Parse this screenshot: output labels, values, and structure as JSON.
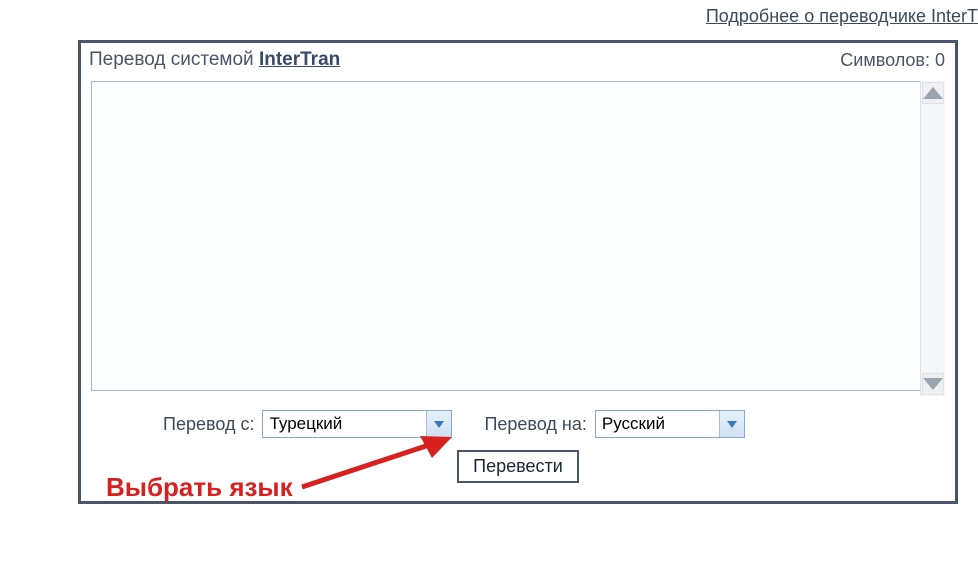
{
  "top_link": "Подробнее о переводчике InterT",
  "header": {
    "prefix": "Перевод системой ",
    "system": "InterTran"
  },
  "char_counter": {
    "label": "Символов: ",
    "value": "0"
  },
  "textarea": {
    "value": ""
  },
  "controls": {
    "from_label": "Перевод с:",
    "from_selected": "Турецкий",
    "to_label": "Перевод на:",
    "to_selected": "Русский"
  },
  "button": {
    "translate": "Перевести"
  },
  "annotation": {
    "text": "Выбрать язык"
  }
}
